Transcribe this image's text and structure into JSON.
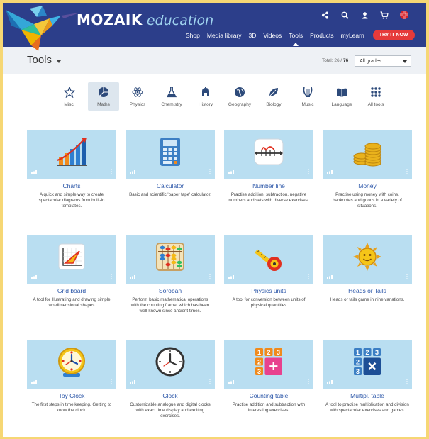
{
  "brand": {
    "name": "MOZAIK",
    "suffix": "education"
  },
  "top_icons": [
    "share-icon",
    "search-icon",
    "user-icon",
    "cart-icon",
    "uk-flag-icon"
  ],
  "nav": {
    "items": [
      {
        "label": "Shop"
      },
      {
        "label": "Media library"
      },
      {
        "label": "3D"
      },
      {
        "label": "Videos"
      },
      {
        "label": "Tools"
      },
      {
        "label": "Products"
      },
      {
        "label": "myLearn"
      }
    ],
    "active": "Tools",
    "cta": "TRY IT NOW"
  },
  "page": {
    "title": "Tools",
    "total_label": "Total: 26 /",
    "total_max": "76",
    "grade_filter": "All grades"
  },
  "categories": [
    {
      "label": "Misc.",
      "icon": "star-icon"
    },
    {
      "label": "Maths",
      "icon": "pie-icon",
      "active": true
    },
    {
      "label": "Physics",
      "icon": "atom-icon"
    },
    {
      "label": "Chemistry",
      "icon": "flask-icon"
    },
    {
      "label": "History",
      "icon": "helmet-icon"
    },
    {
      "label": "Geography",
      "icon": "globe-icon"
    },
    {
      "label": "Biology",
      "icon": "leaf-icon"
    },
    {
      "label": "Music",
      "icon": "lyre-icon"
    },
    {
      "label": "Language",
      "icon": "book-icon"
    },
    {
      "label": "All tools",
      "icon": "grid-icon"
    }
  ],
  "tools": [
    {
      "name": "Charts",
      "desc": "A quick and simple way to create spectacular diagrams from built-in templates.",
      "icon": "bar-chart-icon"
    },
    {
      "name": "Calculator",
      "desc": "Basic and scientific 'paper tape' calculator.",
      "icon": "calculator-icon"
    },
    {
      "name": "Number line",
      "desc": "Practise addition, subtraction, negative numbers and sets with diverse exercises.",
      "icon": "number-line-icon"
    },
    {
      "name": "Money",
      "desc": "Practise using money with coins, banknotes and goods in a variety of situations.",
      "icon": "coins-icon"
    },
    {
      "name": "Grid board",
      "desc": "A tool for illustrating and drawing simple two-dimensional shapes.",
      "icon": "grid-board-icon"
    },
    {
      "name": "Soroban",
      "desc": "Perform basic mathematical operations with the counting frame, which has been well-known since ancient times.",
      "icon": "abacus-icon"
    },
    {
      "name": "Physics units",
      "desc": "A tool for conversion between units of physical quantities",
      "icon": "tape-measure-icon"
    },
    {
      "name": "Heads or Tails",
      "desc": "Heads or tails game in nine variations.",
      "icon": "coin-sun-icon"
    },
    {
      "name": "Toy Clock",
      "desc": "The first steps in time keeping. Getting to know the clock.",
      "icon": "toy-clock-icon"
    },
    {
      "name": "Clock",
      "desc": "Customizable analogue and digital clocks with exact time display and exciting exercises.",
      "icon": "clock-icon"
    },
    {
      "name": "Counting table",
      "desc": "Practise addition and subtraction with interesting exercises.",
      "icon": "counting-table-icon"
    },
    {
      "name": "Multipl. table",
      "desc": "A tool to practise multiplication and division with spectacular exercises and games.",
      "icon": "multiplication-table-icon"
    }
  ],
  "counting_table_digits": [
    "1",
    "2",
    "3",
    "2",
    "3",
    "+"
  ],
  "multipl_table_digits": [
    "1",
    "2",
    "3",
    "2",
    "3",
    "×"
  ],
  "colors": {
    "header": "#2c3e8a",
    "tile": "#b9def1",
    "link": "#2b56a8",
    "cta": "#e63a3a",
    "outer_border": "#f6d774"
  }
}
